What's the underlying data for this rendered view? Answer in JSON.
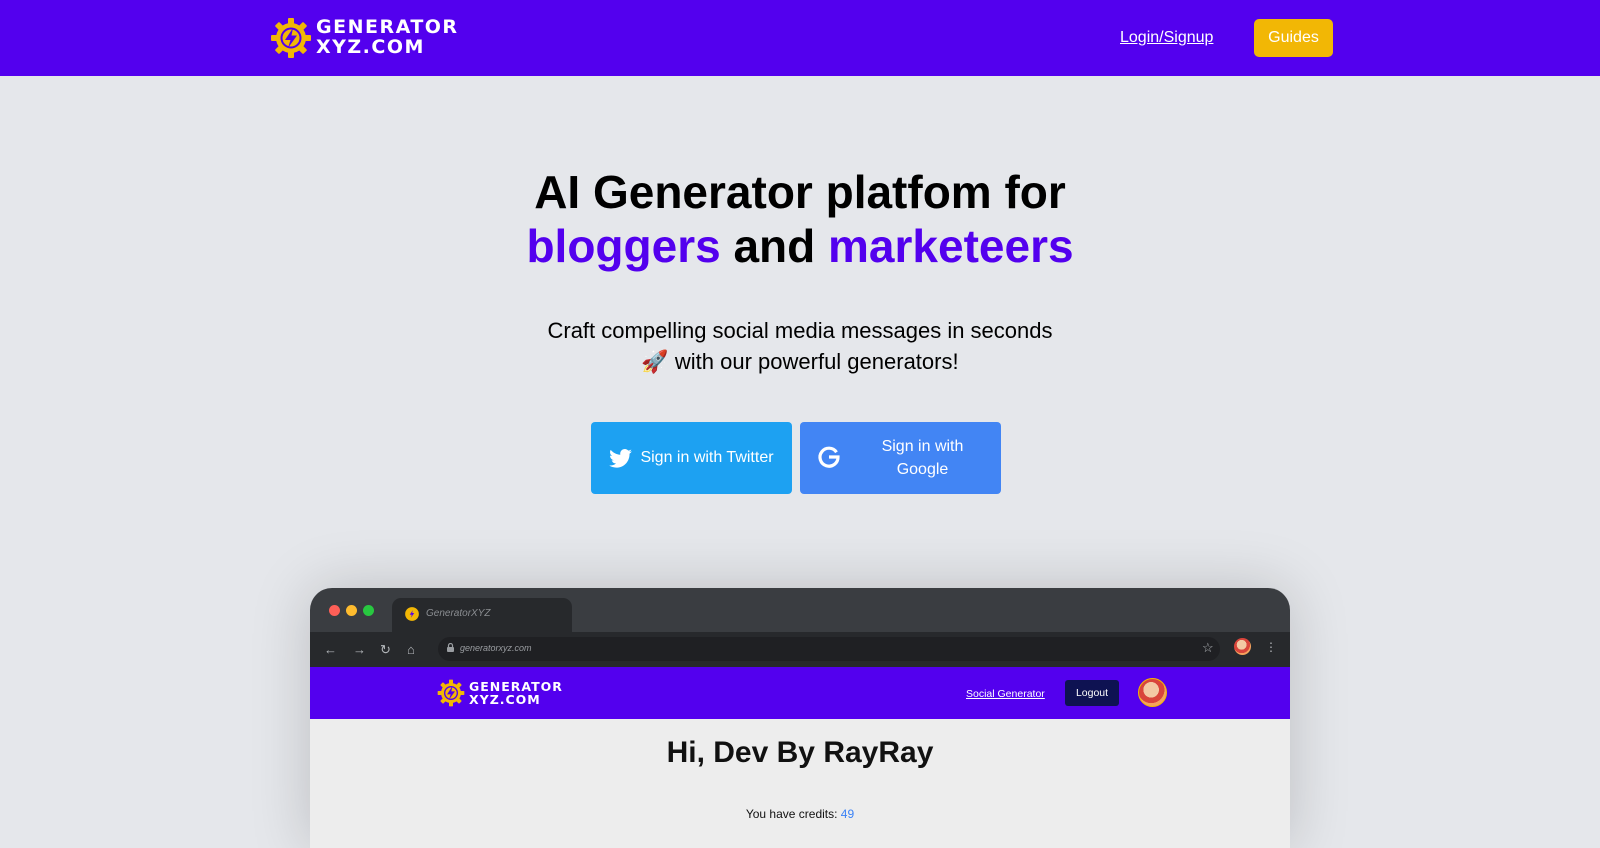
{
  "header": {
    "logo_line1": "GENERATOR",
    "logo_line2": "XYZ.COM",
    "login_label": "Login/Signup",
    "guides_label": "Guides"
  },
  "hero": {
    "title_line1": "AI Generator platfom for",
    "accent1": "bloggers",
    "and": " and ",
    "accent2": "marketeers",
    "sub_line1": "Craft compelling social media messages in seconds",
    "sub_line2": "🚀 with our powerful generators!",
    "twitter_label": "Sign in with Twitter",
    "google_label": "Sign in with Google"
  },
  "mock_browser": {
    "tab_title": "GeneratorXYZ",
    "url": "generatorxyz.com",
    "logo_line1": "GENERATOR",
    "logo_line2": "XYZ.COM",
    "nav_link": "Social Generator",
    "logout_label": "Logout",
    "greeting": "Hi, Dev By RayRay",
    "credits_label": "You have credits: ",
    "credits_value": "49"
  },
  "colors": {
    "brand": "#5300ee",
    "guides": "#f2b705",
    "twitter": "#1da1f2",
    "google": "#4285f4",
    "page_bg": "#e5e7eb"
  },
  "icons": [
    "lightning-gear-logo",
    "twitter-bird-icon",
    "google-g-icon",
    "back-arrow-icon",
    "forward-arrow-icon",
    "reload-icon",
    "home-icon",
    "lock-icon",
    "star-icon",
    "more-menu-icon",
    "avatar"
  ]
}
